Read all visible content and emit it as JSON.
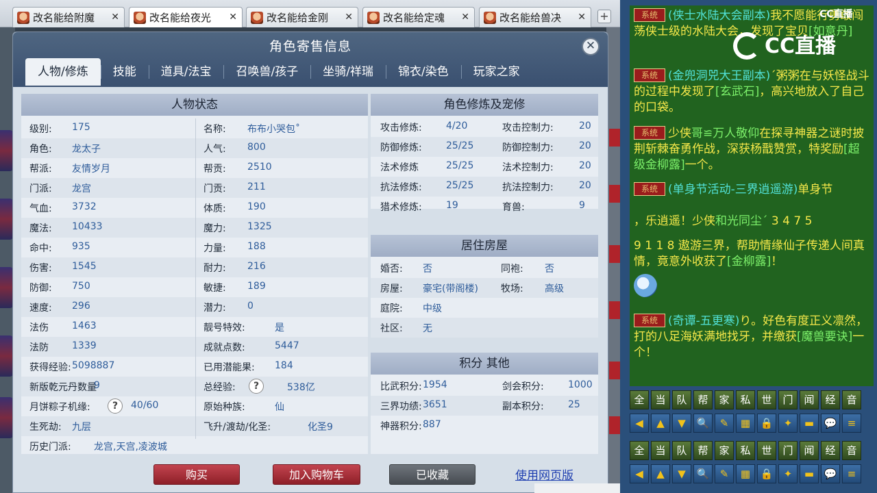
{
  "browser_tabs": [
    {
      "label": "改名能给附魔",
      "active": false
    },
    {
      "label": "改名能给夜光",
      "active": true
    },
    {
      "label": "改名能给金刚",
      "active": false
    },
    {
      "label": "改名能给定魂",
      "active": false
    },
    {
      "label": "改名能给兽决",
      "active": false
    }
  ],
  "new_tab_label": "+",
  "tab_close_symbol": "✕",
  "dialog": {
    "title": "角色寄售信息",
    "close_symbol": "✕",
    "tabs": [
      "人物/修炼",
      "技能",
      "道具/法宝",
      "召唤兽/孩子",
      "坐骑/祥瑞",
      "锦衣/染色",
      "玩家之家"
    ],
    "active_tab": "人物/修炼"
  },
  "status": {
    "header": "人物状态",
    "left_col": [
      {
        "label": "级别:",
        "value": "175"
      },
      {
        "label": "角色:",
        "value": "龙太子"
      },
      {
        "label": "帮派:",
        "value": "友情岁月"
      },
      {
        "label": "门派:",
        "value": "龙宫"
      },
      {
        "label": "气血:",
        "value": "3732"
      },
      {
        "label": "魔法:",
        "value": "10433"
      },
      {
        "label": "命中:",
        "value": "935"
      },
      {
        "label": "伤害:",
        "value": "1545"
      },
      {
        "label": "防御:",
        "value": "750"
      },
      {
        "label": "速度:",
        "value": "296"
      },
      {
        "label": "法伤",
        "value": "1463"
      },
      {
        "label": "法防",
        "value": "1339"
      },
      {
        "label": "获得经验:",
        "value": "5098887"
      },
      {
        "label": "新版乾元丹数量",
        "value": "9"
      },
      {
        "label": "月饼粽子机缘:",
        "value": "40/60"
      },
      {
        "label": "生死劫:",
        "value": "九层"
      },
      {
        "label": "历史门派:",
        "value": "龙宫,天宫,凌波城"
      }
    ],
    "right_col": [
      {
        "label": "名称:",
        "value": "布布小哭包˚"
      },
      {
        "label": "人气:",
        "value": "800"
      },
      {
        "label": "帮贡:",
        "value": "2510"
      },
      {
        "label": "门贡:",
        "value": "211"
      },
      {
        "label": "体质:",
        "value": "190"
      },
      {
        "label": "魔力:",
        "value": "1325"
      },
      {
        "label": "力量:",
        "value": "188"
      },
      {
        "label": "耐力:",
        "value": "216"
      },
      {
        "label": "敏捷:",
        "value": "189"
      },
      {
        "label": "潜力:",
        "value": "0"
      },
      {
        "label": "靓号特效:",
        "value": "是"
      },
      {
        "label": "成就点数:",
        "value": "5447"
      },
      {
        "label": "已用潜能果:",
        "value": "184"
      },
      {
        "label": "总经验:",
        "value": "538亿"
      },
      {
        "label": "原始种族:",
        "value": "仙"
      },
      {
        "label": "飞升/渡劫/化圣:",
        "value": "化圣9"
      }
    ],
    "help_symbol": "?"
  },
  "cultivation": {
    "header": "角色修炼及宠修",
    "rows": [
      {
        "l1": "攻击修炼:",
        "v1": "4/20",
        "l2": "攻击控制力:",
        "v2": "20"
      },
      {
        "l1": "防御修炼:",
        "v1": "25/25",
        "l2": "防御控制力:",
        "v2": "20"
      },
      {
        "l1": "法术修炼",
        "v1": "25/25",
        "l2": "法术控制力:",
        "v2": "20"
      },
      {
        "l1": "抗法修炼:",
        "v1": "25/25",
        "l2": "抗法控制力:",
        "v2": "20"
      },
      {
        "l1": "猎术修炼:",
        "v1": "19",
        "l2": "育兽:",
        "v2": "9"
      }
    ]
  },
  "housing": {
    "header": "居住房屋",
    "rows": [
      {
        "l1": "婚否:",
        "v1": "否",
        "l2": "同袍:",
        "v2": "否"
      },
      {
        "l1": "房屋:",
        "v1": "豪宅(带阁楼)",
        "l2": "牧场:",
        "v2": "高级"
      },
      {
        "l1": "庭院:",
        "v1": "中级",
        "l2": "",
        "v2": ""
      },
      {
        "l1": "社区:",
        "v1": "无",
        "l2": "",
        "v2": ""
      }
    ]
  },
  "points": {
    "header": "积分 其他",
    "rows": [
      {
        "l1": "比武积分:",
        "v1": "1954",
        "l2": "剑会积分:",
        "v2": "1000"
      },
      {
        "l1": "三界功绩:",
        "v1": "3651",
        "l2": "副本积分:",
        "v2": "25"
      },
      {
        "l1": "神器积分:",
        "v1": "887",
        "l2": "",
        "v2": ""
      }
    ]
  },
  "buttons": {
    "buy": "购买",
    "add_cart": "加入购物车",
    "favorited": "已收藏",
    "web_version": "使用网页版"
  },
  "chat": {
    "badge": "系统",
    "messages": [
      {
        "parts": [
          [
            "cyan",
            "(侠士水陆大会副本)"
          ],
          [
            "yel",
            "我不愿能行勇敢闯荡侠士级的水陆大会，发现了宝贝"
          ],
          [
            "grn",
            "[如意丹]"
          ]
        ]
      },
      {
        "parts": [
          [
            "cyan",
            "(金兜洞兕大王副本)"
          ],
          [
            "yel",
            "´粥粥在与妖怪战斗的过程中发现了"
          ],
          [
            "grn",
            "[玄武石]"
          ],
          [
            "yel",
            "，高兴地放入了自己的口袋。"
          ]
        ]
      },
      {
        "parts": [
          [
            "yel",
            "少侠"
          ],
          [
            "grn",
            "哥≌万人敬仰"
          ],
          [
            "yel",
            "在探寻神器之谜时披荆斩棘奋勇作战，深获杨戬赞赏，特奖励"
          ],
          [
            "grn",
            "[超级金柳露]"
          ],
          [
            "yel",
            "一个。"
          ]
        ]
      },
      {
        "parts": [
          [
            "cyan",
            "(单身节活动-三界逍遥游)"
          ],
          [
            "yel",
            "单身节"
          ]
        ]
      },
      {
        "parts": [
          [
            "yel",
            "，乐逍遥！少侠"
          ],
          [
            "grn",
            "和光同尘´"
          ],
          [
            "yel",
            " 3 4 7 5"
          ]
        ]
      },
      {
        "parts": [
          [
            "yel",
            "9 1 1 8 遨游三界，帮助情缘仙子传递人间真情，竟意外收获了"
          ],
          [
            "grn",
            "[金柳露]"
          ],
          [
            "yel",
            "！"
          ]
        ]
      },
      {
        "parts": [
          [
            "cyan",
            "(奇谭-五更寒)"
          ],
          [
            "yel",
            "り。好色有度正义凛然，打的八足海妖满地找牙，并缴获"
          ],
          [
            "grn",
            "[魔兽要诀]"
          ],
          [
            "yel",
            "一个！"
          ]
        ]
      }
    ],
    "channel_row1": [
      "全",
      "当",
      "队",
      "帮",
      "家",
      "私",
      "世",
      "门",
      "闻",
      "经",
      "音"
    ],
    "icon_row1": [
      "◀",
      "▲",
      "▼",
      "🔍",
      "✎",
      "▦",
      "🔒",
      "✦",
      "▬",
      "💬",
      "≡"
    ],
    "channel_row2": [
      "全",
      "当",
      "队",
      "帮",
      "家",
      "私",
      "世",
      "门",
      "闻",
      "经",
      "音"
    ],
    "icon_row2": [
      "◀",
      "▲",
      "▼",
      "🔍",
      "✎",
      "▦",
      "🔒",
      "✦",
      "▬",
      "💬",
      "≡"
    ]
  },
  "watermark": {
    "big": "CC直播",
    "small": "CC直播"
  }
}
